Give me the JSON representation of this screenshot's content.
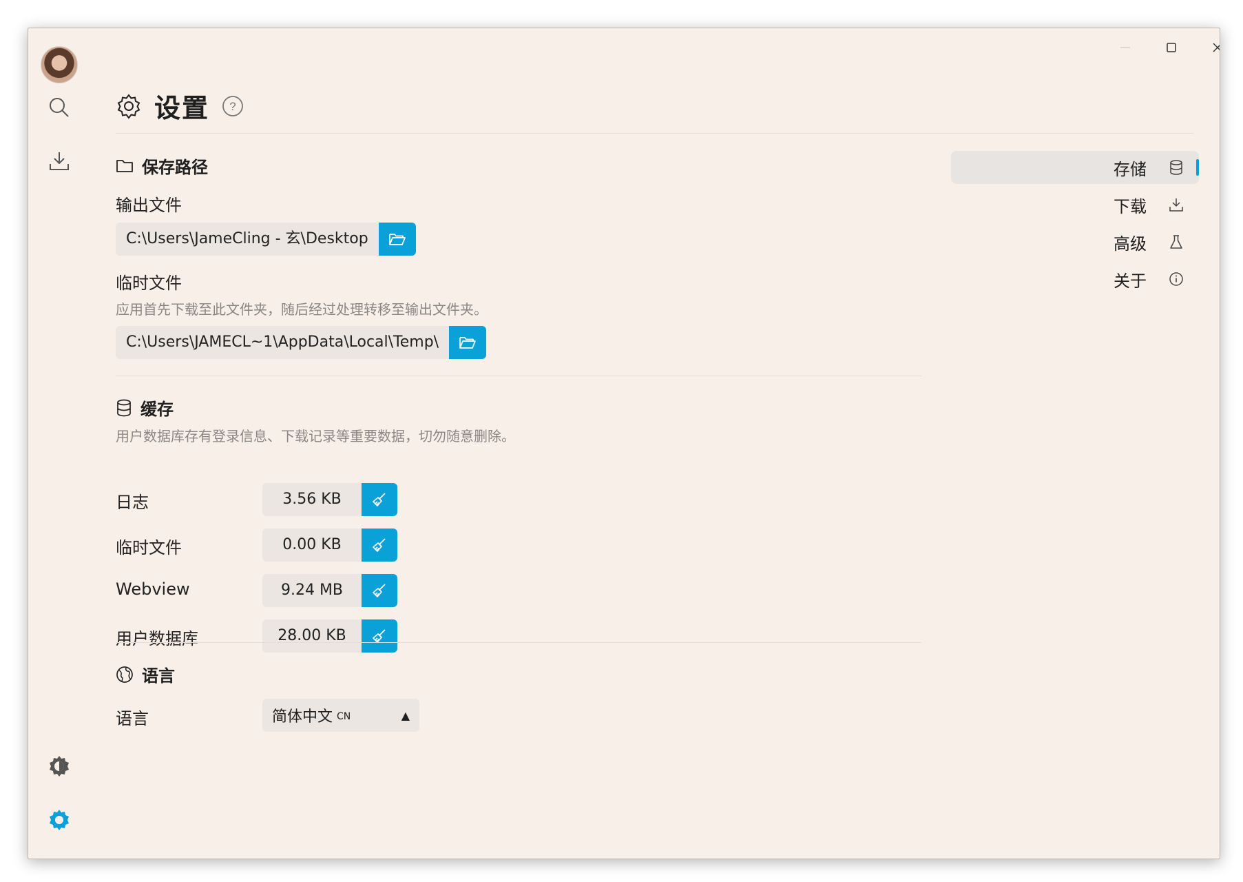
{
  "window": {
    "controls": {
      "minimize_icon": "minimize-icon",
      "maximize_icon": "maximize-icon",
      "close_icon": "close-icon"
    }
  },
  "sidebar": {
    "items": [
      {
        "name": "search",
        "icon": "search-icon"
      },
      {
        "name": "downloads",
        "icon": "download-icon"
      },
      {
        "name": "theme",
        "icon": "theme-icon"
      },
      {
        "name": "settings",
        "icon": "settings-icon",
        "active": true
      }
    ]
  },
  "header": {
    "title": "设置",
    "icon": "gear-icon",
    "help_icon": "help-icon"
  },
  "save_path": {
    "title": "保存路径",
    "output": {
      "label": "输出文件",
      "value": "C:\\Users\\JameCling - 玄\\Desktop"
    },
    "temp": {
      "label": "临时文件",
      "hint": "应用首先下载至此文件夹，随后经过处理转移至输出文件夹。",
      "value": "C:\\Users\\JAMECL~1\\AppData\\Local\\Temp\\"
    }
  },
  "cache": {
    "title": "缓存",
    "hint": "用户数据库存有登录信息、下载记录等重要数据，切勿随意删除。",
    "items": [
      {
        "label": "日志",
        "value": "3.56 KB"
      },
      {
        "label": "临时文件",
        "value": "0.00 KB"
      },
      {
        "label": "Webview",
        "value": "9.24 MB"
      },
      {
        "label": "用户数据库",
        "value": "28.00 KB"
      }
    ]
  },
  "language": {
    "title": "语言",
    "label": "语言",
    "selected": "简体中文",
    "code": "CN",
    "arrow": "▲"
  },
  "right_nav": {
    "items": [
      {
        "label": "存储",
        "icon": "database-icon",
        "active": true
      },
      {
        "label": "下载",
        "icon": "download-icon"
      },
      {
        "label": "高级",
        "icon": "flask-icon"
      },
      {
        "label": "关于",
        "icon": "info-icon"
      }
    ]
  },
  "colors": {
    "accent": "#0aa0d8",
    "background": "#f8efe8",
    "field": "#ebe6e2"
  }
}
